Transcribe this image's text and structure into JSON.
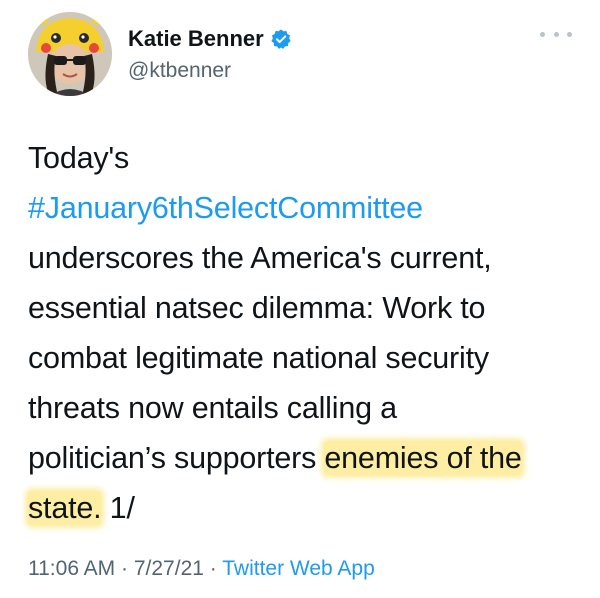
{
  "tweet": {
    "display_name": "Katie Benner",
    "handle": "@ktbenner",
    "body": {
      "line1": "Today's",
      "hashtag": "#January6thSelectCommittee",
      "line3": "underscores the America's current,",
      "line4": "essential natsec dilemma: Work to",
      "line5": "combat legitimate national security",
      "line6": "threats now entails calling a",
      "line7_plain": "politician’s supporters ",
      "line7_highlight": "enemies of the",
      "line8_highlight": "state.",
      "line8_tail": " 1/"
    },
    "time": "11:06 AM",
    "separator": "·",
    "date": "7/27/21",
    "source": "Twitter Web App"
  },
  "colors": {
    "link": "#1d9bf0",
    "secondary_text": "#536471",
    "highlight": "#fdeea3",
    "verified_badge": "#1d9bf0"
  },
  "icons": {
    "verified": "verified-badge-icon",
    "more": "more-options-icon"
  }
}
